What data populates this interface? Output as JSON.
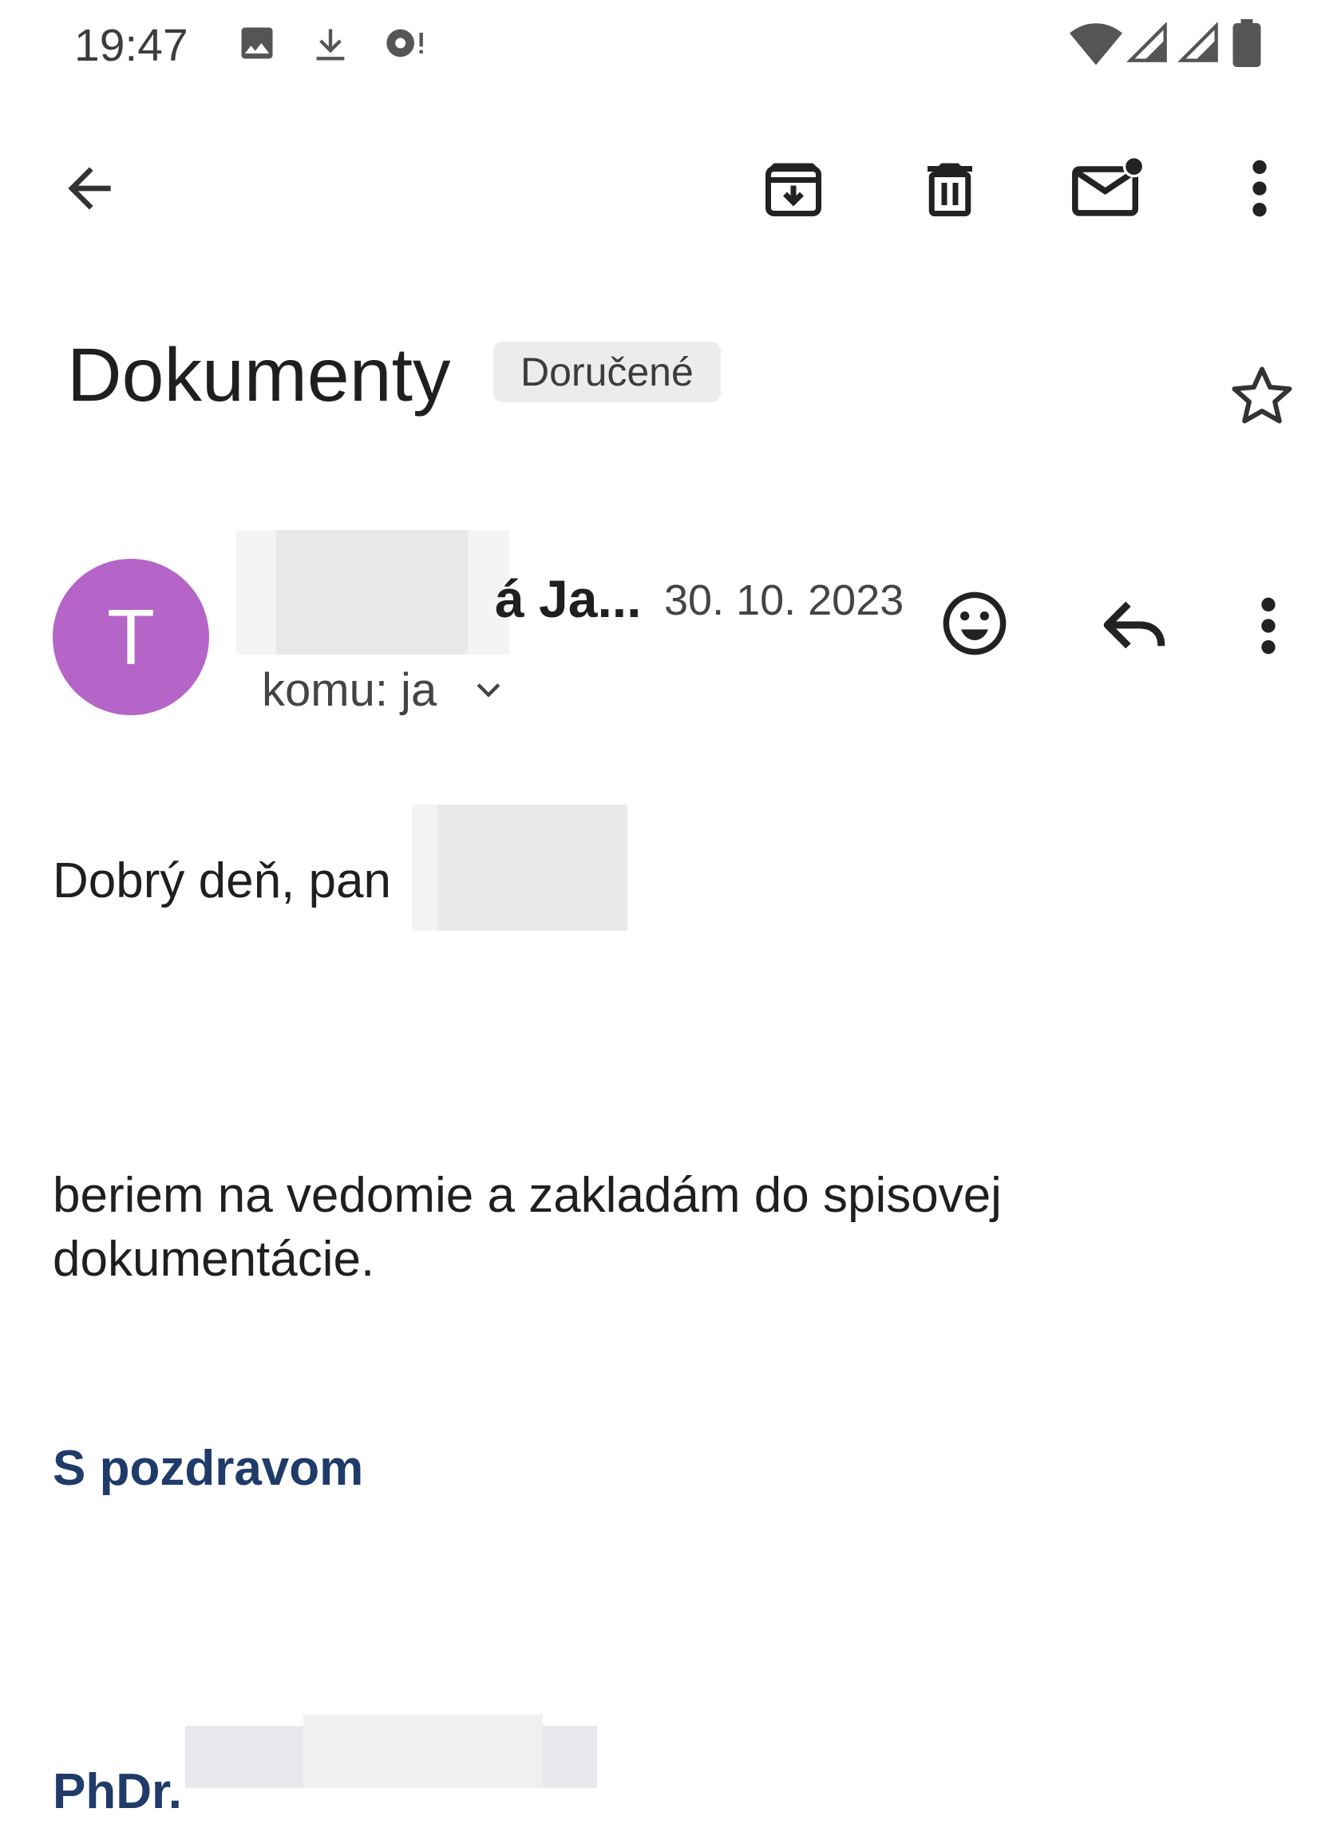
{
  "status_bar": {
    "time": "19:47",
    "left_icons": [
      "image-icon",
      "download-icon",
      "sync-icon"
    ],
    "right_icons": [
      "wifi-icon",
      "signal-icon",
      "signal-icon",
      "battery-icon"
    ]
  },
  "toolbar": {
    "back_icon": "arrow-back-icon",
    "actions": [
      "archive-icon",
      "delete-icon",
      "mark-unread-icon",
      "more-vert-icon"
    ]
  },
  "email": {
    "subject": "Dokumenty",
    "label": "Doručené",
    "sender": {
      "avatar_letter": "T",
      "avatar_color": "#b565c8",
      "name_visible": "á Ja...",
      "date": "30. 10. 2023",
      "recipient": "komu: ja"
    },
    "body": {
      "greeting": "Dobrý deň, pan",
      "paragraph_line1": "beriem na vedomie a zakladám do spisovej",
      "paragraph_line2": "dokumentácie.",
      "signoff": "S pozdravom",
      "signature_start": "PhDr."
    }
  },
  "colors": {
    "background": "#ffffff",
    "text": "#1f1f1f",
    "signature": "#1f3b69",
    "chip_bg": "#ececec"
  }
}
